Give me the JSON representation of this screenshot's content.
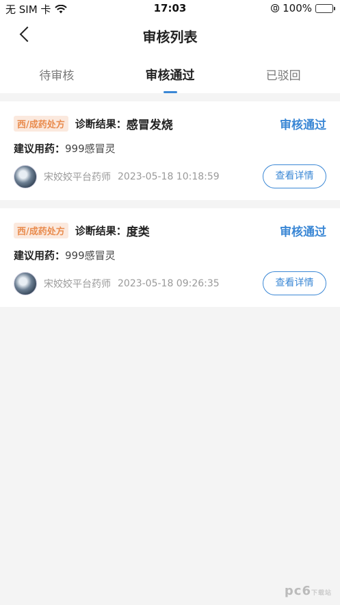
{
  "status_bar": {
    "carrier": "无 SIM 卡",
    "time": "17:03",
    "battery": "100%",
    "icons": [
      "wifi-icon",
      "orientation-lock-icon",
      "battery-icon"
    ]
  },
  "nav": {
    "title": "审核列表"
  },
  "tabs": [
    {
      "label": "待审核"
    },
    {
      "label": "审核通过"
    },
    {
      "label": "已驳回"
    }
  ],
  "active_tab": 1,
  "records": [
    {
      "rx_type": "西/成药处方",
      "diagnosis_label": "诊断结果：",
      "diagnosis": "感冒发烧",
      "status": "审核通过",
      "med_label": "建议用药：",
      "med": "999感冒灵",
      "pharmacist": "宋姣姣平台药师",
      "time": "2023-05-18 10:18:59",
      "detail_label": "查看详情"
    },
    {
      "rx_type": "西/成药处方",
      "diagnosis_label": "诊断结果：",
      "diagnosis": "度类",
      "status": "审核通过",
      "med_label": "建议用药：",
      "med": "999感冒灵",
      "pharmacist": "宋姣姣平台药师",
      "time": "2023-05-18 09:26:35",
      "detail_label": "查看详情"
    }
  ],
  "watermark": {
    "text": "pc6",
    "sub": "下载站"
  },
  "colors": {
    "accent": "#3a87d5",
    "tag_bg": "#fbe9de",
    "tag_text": "#e98b4d",
    "background": "#f4f4f4"
  }
}
